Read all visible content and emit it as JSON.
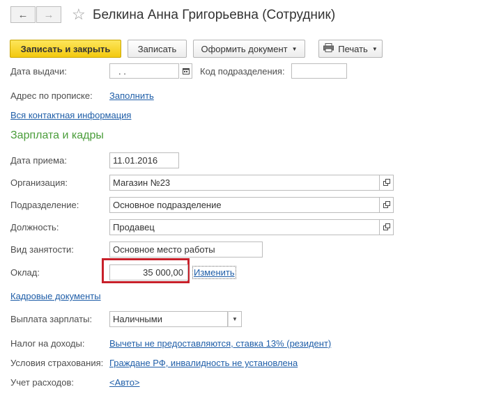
{
  "window": {
    "title": "Белкина Анна Григорьевна (Сотрудник)"
  },
  "nav": {
    "back_glyph": "←",
    "forward_glyph": "→",
    "star_glyph": "☆"
  },
  "toolbar": {
    "save_close_label": "Записать и закрыть",
    "save_label": "Записать",
    "create_doc_label": "Оформить документ",
    "print_label": "Печать"
  },
  "fields": {
    "issue_date_label": "Дата выдачи:",
    "issue_date_value": " .  .",
    "division_code_label": "Код подразделения:",
    "division_code_value": "",
    "address_label": "Адрес по прописке:",
    "address_link": "Заполнить",
    "contacts_link": "Вся контактная информация"
  },
  "section": {
    "title": "Зарплата и кадры"
  },
  "hr": {
    "hire_date_label": "Дата приема:",
    "hire_date_value": "11.01.2016",
    "org_label": "Организация:",
    "org_value": "Магазин №23",
    "dept_label": "Подразделение:",
    "dept_value": "Основное подразделение",
    "position_label": "Должность:",
    "position_value": "Продавец",
    "employment_label": "Вид занятости:",
    "employment_value": "Основное место работы",
    "salary_label": "Оклад:",
    "salary_value": "35 000,00",
    "salary_change_link": "Изменить",
    "hr_docs_link": "Кадровые документы",
    "payout_label": "Выплата зарплаты:",
    "payout_value": "Наличными",
    "tax_label": "Налог на доходы:",
    "tax_link": "Вычеты не предоставляются, ставка 13% (резидент)",
    "insurance_label": "Условия страхования:",
    "insurance_link": "Граждане РФ, инвалидность не установлена",
    "expenses_label": "Учет расходов:",
    "expenses_link": "<Авто>"
  },
  "colors": {
    "accent_yellow": "#f3c90f",
    "link_blue": "#1f5ea8",
    "section_green": "#4a9d3a",
    "highlight_red": "#c8202a"
  }
}
